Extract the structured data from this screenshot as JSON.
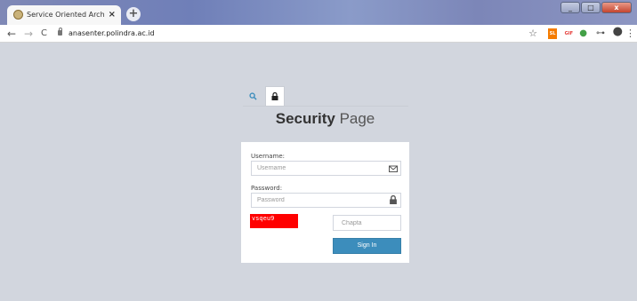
{
  "browser": {
    "tab_title": "Service Oriented Architecture (S",
    "tab_close": "×",
    "new_tab": "+",
    "url": "anasenter.polindra.ac.id",
    "nav": {
      "back": "←",
      "forward": "→",
      "reload": "C"
    },
    "window_controls": {
      "minimize": "_",
      "maximize": "□",
      "close": "x"
    },
    "extensions": [
      {
        "name": "star-icon",
        "label": "☆",
        "color": "#555555"
      },
      {
        "name": "extension-sl-icon",
        "label": "SL",
        "color": "#f57c00"
      },
      {
        "name": "extension-gif-icon",
        "label": "GIF",
        "color": "#e53935"
      },
      {
        "name": "extension-green-icon",
        "label": "●",
        "color": "#43a047"
      },
      {
        "name": "key-icon",
        "label": "⊶",
        "color": "#555555"
      },
      {
        "name": "profile-avatar",
        "label": "●",
        "color": "#444444"
      },
      {
        "name": "menu-icon",
        "label": "⋮",
        "color": "#555555"
      }
    ]
  },
  "page": {
    "heading_bold": "Security",
    "heading_light": "Page",
    "form": {
      "username_label": "Username:",
      "username_placeholder": "Username",
      "password_label": "Password:",
      "password_placeholder": "Password",
      "captcha_text": "vsqeu9",
      "captcha_placeholder": "Chapta",
      "signin_label": "Sign In"
    }
  },
  "colors": {
    "background": "#d2d6de",
    "primary_button": "#3c8dbc",
    "captcha_bg": "#ff0000"
  }
}
